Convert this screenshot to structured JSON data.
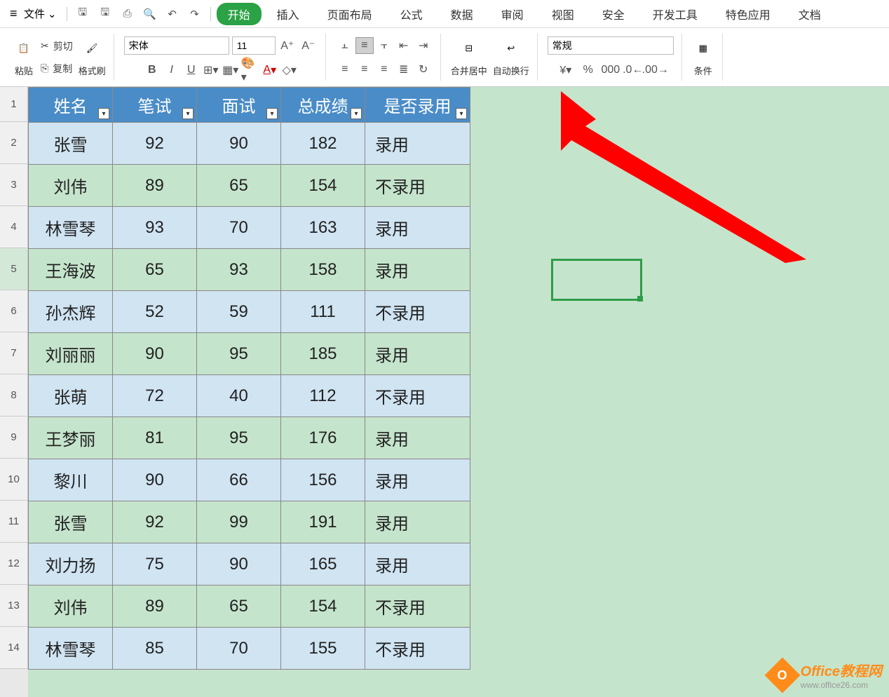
{
  "menubar": {
    "file": "文件",
    "tabs": [
      "开始",
      "插入",
      "页面布局",
      "公式",
      "数据",
      "审阅",
      "视图",
      "安全",
      "开发工具",
      "特色应用",
      "文档"
    ]
  },
  "ribbon": {
    "paste": "粘贴",
    "cut": "剪切",
    "copy": "复制",
    "format_painter": "格式刷",
    "font_name": "宋体",
    "font_size": "11",
    "merge": "合并居中",
    "wrap": "自动换行",
    "number_format": "常规",
    "cond_format": "条件"
  },
  "headers": [
    "姓名",
    "笔试",
    "面试",
    "总成绩",
    "是否录用"
  ],
  "rows": [
    {
      "n": "2",
      "name": "张雪",
      "written": "92",
      "interview": "90",
      "total": "182",
      "status": "录用",
      "cls": "blue"
    },
    {
      "n": "3",
      "name": "刘伟",
      "written": "89",
      "interview": "65",
      "total": "154",
      "status": "不录用",
      "cls": "green"
    },
    {
      "n": "4",
      "name": "林雪琴",
      "written": "93",
      "interview": "70",
      "total": "163",
      "status": "录用",
      "cls": "blue"
    },
    {
      "n": "5",
      "name": "王海波",
      "written": "65",
      "interview": "93",
      "total": "158",
      "status": "录用",
      "cls": "green"
    },
    {
      "n": "6",
      "name": "孙杰辉",
      "written": "52",
      "interview": "59",
      "total": "111",
      "status": "不录用",
      "cls": "blue"
    },
    {
      "n": "7",
      "name": "刘丽丽",
      "written": "90",
      "interview": "95",
      "total": "185",
      "status": "录用",
      "cls": "green"
    },
    {
      "n": "8",
      "name": "张萌",
      "written": "72",
      "interview": "40",
      "total": "112",
      "status": "不录用",
      "cls": "blue"
    },
    {
      "n": "9",
      "name": "王梦丽",
      "written": "81",
      "interview": "95",
      "total": "176",
      "status": "录用",
      "cls": "green"
    },
    {
      "n": "10",
      "name": "黎川",
      "written": "90",
      "interview": "66",
      "total": "156",
      "status": "录用",
      "cls": "blue"
    },
    {
      "n": "11",
      "name": "张雪",
      "written": "92",
      "interview": "99",
      "total": "191",
      "status": "录用",
      "cls": "green"
    },
    {
      "n": "12",
      "name": "刘力扬",
      "written": "75",
      "interview": "90",
      "total": "165",
      "status": "录用",
      "cls": "blue"
    },
    {
      "n": "13",
      "name": "刘伟",
      "written": "89",
      "interview": "65",
      "total": "154",
      "status": "不录用",
      "cls": "green"
    },
    {
      "n": "14",
      "name": "林雪琴",
      "written": "85",
      "interview": "70",
      "total": "155",
      "status": "不录用",
      "cls": "blue"
    }
  ],
  "watermark": {
    "logo": "O",
    "title": "Office教程网",
    "url": "www.office26.com"
  }
}
